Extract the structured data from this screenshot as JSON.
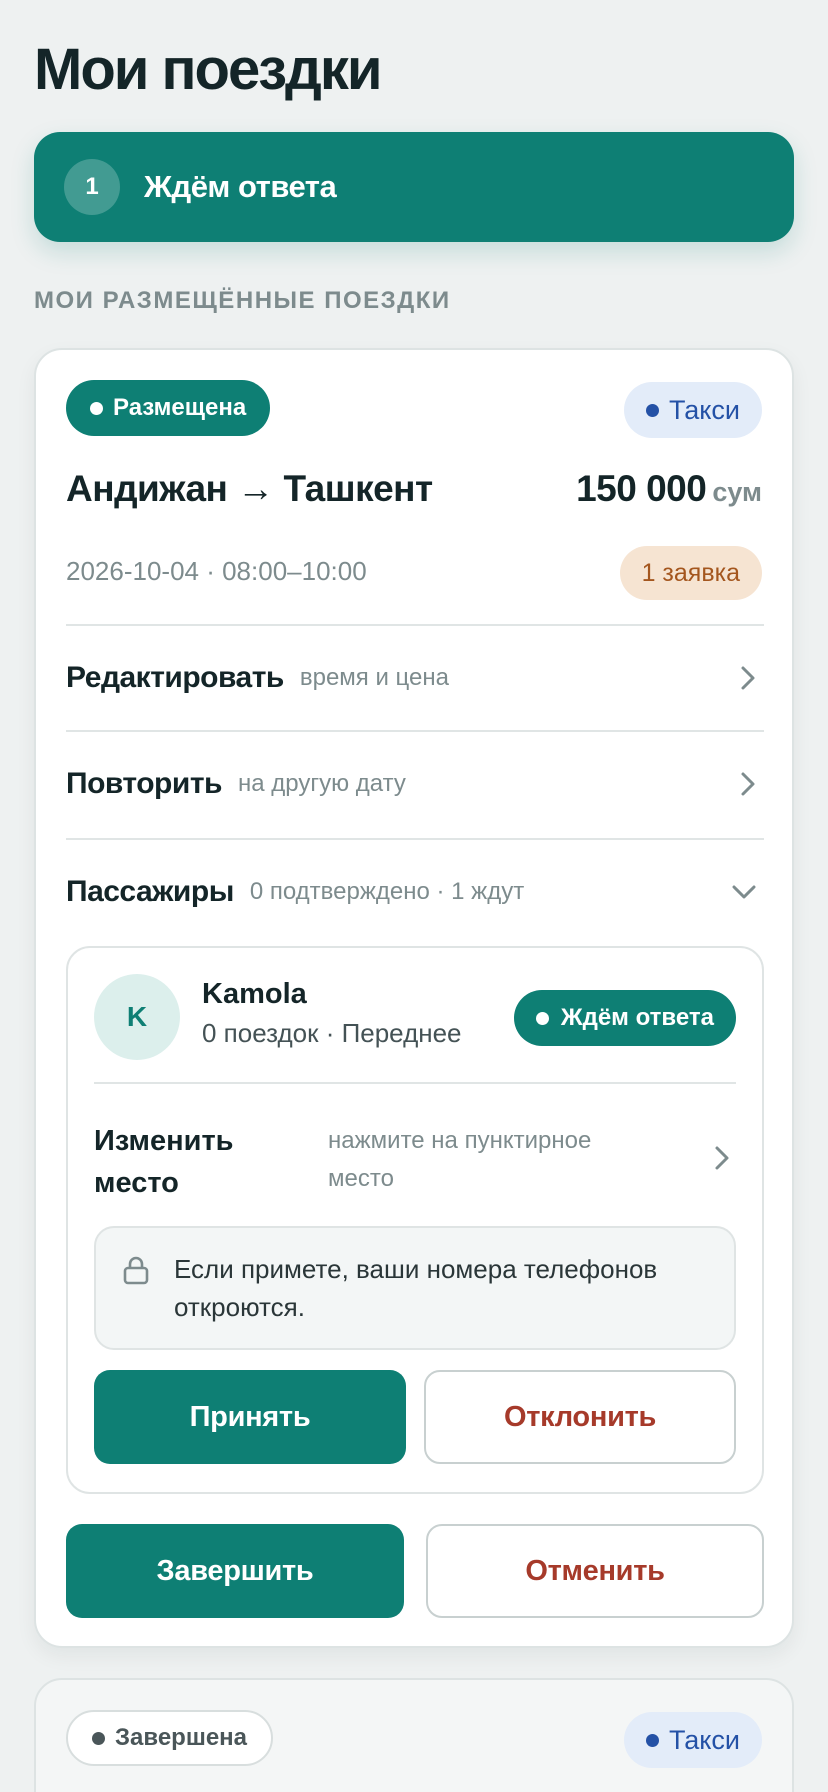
{
  "page": {
    "title": "Мои поездки"
  },
  "banner": {
    "count": "1",
    "label": "Ждём ответа"
  },
  "section": {
    "label": "МОИ РАЗМЕЩЁННЫЕ ПОЕЗДКИ"
  },
  "trips": [
    {
      "status": "Размещена",
      "type": "Такси",
      "route": "Андижан → Ташкент",
      "price": "150 000",
      "currency": "сум",
      "datetime": "2026-10-04 · 08:00–10:00",
      "requests": "1 заявка",
      "actions": [
        {
          "title": "Редактировать",
          "subtitle": "время и цена"
        },
        {
          "title": "Повторить",
          "subtitle": "на другую дату"
        },
        {
          "title": "Пассажиры",
          "subtitle": "0 подтверждено · 1 ждут"
        }
      ],
      "passenger": {
        "initial": "K",
        "name": "Kamola",
        "meta": "0 поездок · Переднее",
        "status": "Ждём ответа",
        "seat_title": "Изменить место",
        "seat_hint": "нажмите на пунктирное место",
        "notice": "Если примете, ваши номера телефонов откроются.",
        "accept": "Принять",
        "decline": "Отклонить"
      },
      "finish": "Завершить",
      "cancel": "Отменить"
    },
    {
      "status": "Завершена",
      "type": "Такси"
    }
  ],
  "colors": {
    "accent": "#0e7f74",
    "danger": "#a63a2a",
    "taxi": "#2451a6",
    "request_badge": "#a4561e"
  },
  "icons": [
    "chevron-right-icon",
    "chevron-down-icon",
    "lock-icon",
    "dot-icon"
  ]
}
